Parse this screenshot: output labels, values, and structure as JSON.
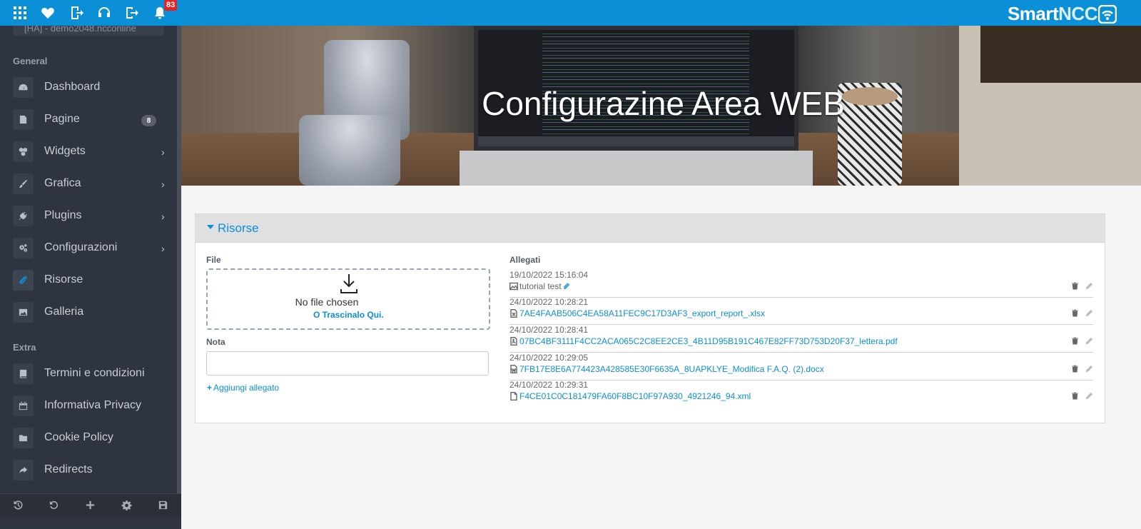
{
  "topbar": {
    "icons": [
      "apps-grid-icon",
      "heart-icon",
      "device-exit-icon",
      "headset-icon",
      "sign-out-icon",
      "bell-icon"
    ],
    "notification_count": "83",
    "brand_part1": "Smart",
    "brand_part2": "NCC",
    "bg_color": "#0b8fd6"
  },
  "sidebar": {
    "search_stub": "[HA] - demo2048.ncconline",
    "section_general": "General",
    "section_extra": "Extra",
    "items": [
      {
        "label": "Dashboard",
        "icon": "dashboard-icon"
      },
      {
        "label": "Pagine",
        "icon": "page-icon",
        "count": "8"
      },
      {
        "label": "Widgets",
        "icon": "cubes-icon",
        "has_submenu": true
      },
      {
        "label": "Grafica",
        "icon": "brush-icon",
        "has_submenu": true
      },
      {
        "label": "Plugins",
        "icon": "plug-icon",
        "has_submenu": true
      },
      {
        "label": "Configurazioni",
        "icon": "cogs-icon",
        "has_submenu": true
      },
      {
        "label": "Risorse",
        "icon": "paperclip-icon",
        "active": true
      },
      {
        "label": "Galleria",
        "icon": "image-icon"
      },
      {
        "label": "Termini e condizioni",
        "icon": "book-icon"
      },
      {
        "label": "Informativa Privacy",
        "icon": "calendar-icon"
      },
      {
        "label": "Cookie Policy",
        "icon": "folder-icon"
      },
      {
        "label": "Redirects",
        "icon": "share-icon"
      }
    ],
    "bottom_icons": [
      "history-icon",
      "undo-icon",
      "plus-icon",
      "gear-icon",
      "save-icon"
    ]
  },
  "hero": {
    "title": "Configurazine Area WEB"
  },
  "panel": {
    "title": "Risorse",
    "file_label": "File",
    "no_file_text": "No file chosen",
    "drag_text": "O Trascinalo Qui.",
    "nota_label": "Nota",
    "nota_value": "",
    "add_label": "Aggiungi allegato",
    "allegati_label": "Allegati",
    "attachments": [
      {
        "date": "19/10/2022 15:16:04",
        "name": "tutorial test",
        "type": "image-file-icon",
        "linked": false
      },
      {
        "date": "24/10/2022 10:28:21",
        "name": "7AE4FAAB506C4EA58A11FEC9C17D3AF3_export_report_.xlsx",
        "type": "excel-file-icon",
        "linked": true
      },
      {
        "date": "24/10/2022 10:28:41",
        "name": "07BC4BF3111F4CC2ACA065C2C8EE2CE3_4B11D95B191C467E82FF73D753D20F37_lettera.pdf",
        "type": "pdf-file-icon",
        "linked": true
      },
      {
        "date": "24/10/2022 10:29:05",
        "name": "7FB17E8E6A774423A428585E30F6635A_8UAPKLYE_Modifica F.A.Q. (2).docx",
        "type": "word-file-icon",
        "linked": true
      },
      {
        "date": "24/10/2022 10:29:31",
        "name": "F4CE01C0C181479FA60F8BC10F97A930_4921246_94.xml",
        "type": "generic-file-icon",
        "linked": true
      }
    ]
  }
}
